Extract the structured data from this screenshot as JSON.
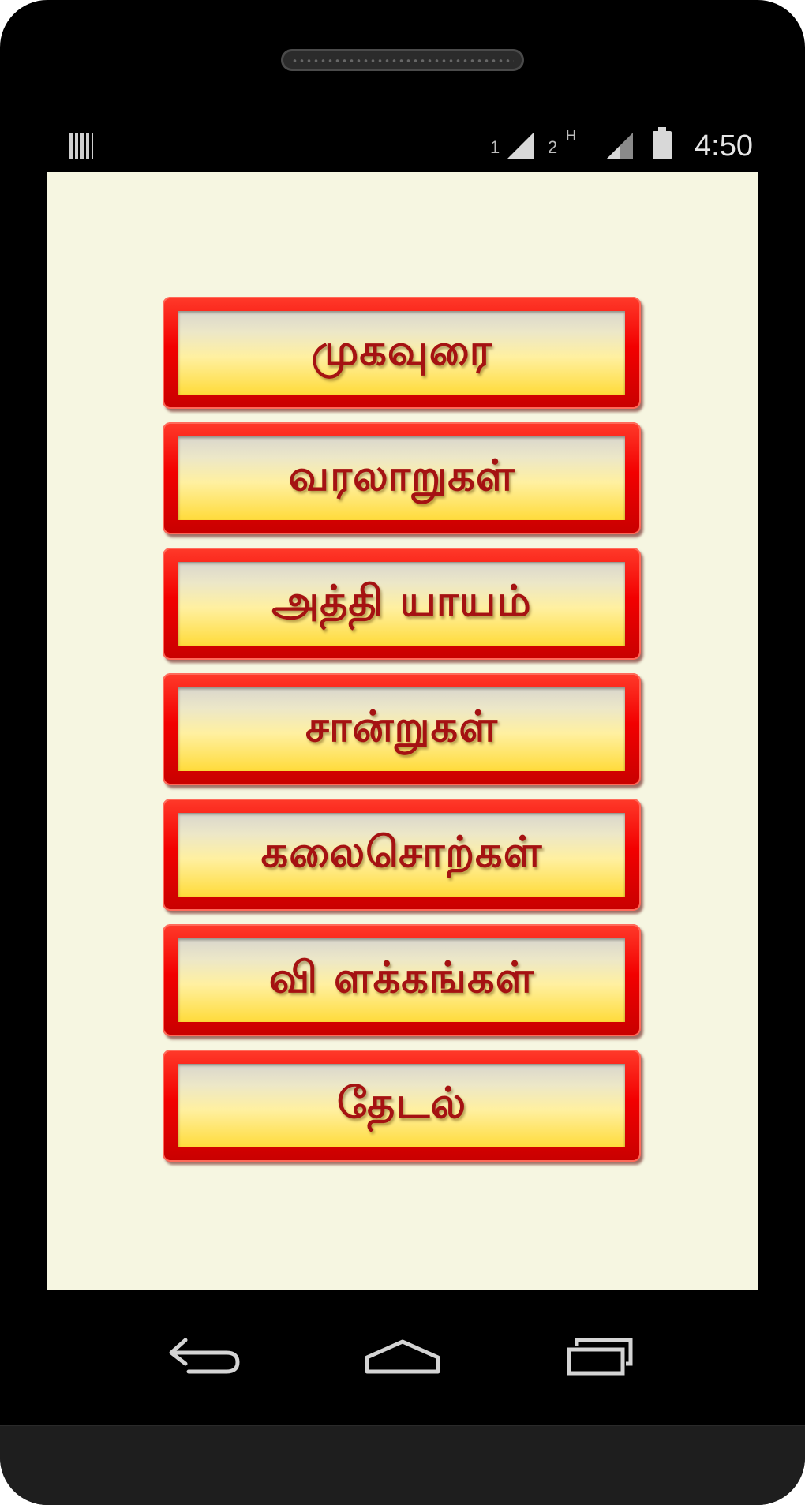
{
  "status_bar": {
    "sim1_label": "1",
    "sim2_label": "2",
    "data_indicator": "H",
    "time": "4:50",
    "icons": [
      "barcode-icon",
      "signal-sim1-icon",
      "signal-sim2-icon",
      "battery-charging-icon"
    ]
  },
  "menu": {
    "items": [
      {
        "label": "முகவுரை"
      },
      {
        "label": "வரலாறுகள்"
      },
      {
        "label": "அத்தி யாயம்"
      },
      {
        "label": "சான்றுகள்"
      },
      {
        "label": "கலைசொற்கள்"
      },
      {
        "label": "வி ளக்கங்கள்"
      },
      {
        "label": "தேடல்"
      }
    ]
  },
  "nav_bar": {
    "icons": [
      "back-icon",
      "home-icon",
      "recent-apps-icon"
    ]
  },
  "colors": {
    "screen_background": "#f6f6e1",
    "button_frame": "#f20000",
    "button_face_top": "#d9d6cc",
    "button_face_bottom": "#ffdb3a",
    "label_text": "#a51212"
  }
}
